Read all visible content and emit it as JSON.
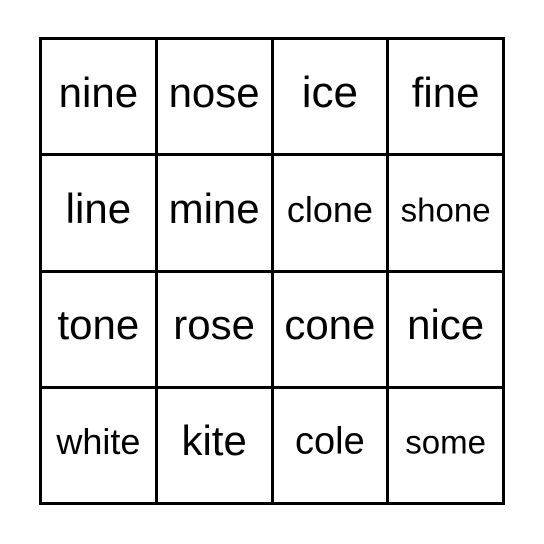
{
  "card": {
    "type": "bingo-card",
    "rows": 4,
    "columns": 4,
    "background_color": "#ffffff",
    "border_color": "#000000",
    "text_color": "#000000",
    "border_width_px": 3,
    "cells": [
      {
        "word": "nine",
        "row": 1,
        "col": 1,
        "size": "lg"
      },
      {
        "word": "nose",
        "row": 1,
        "col": 2,
        "size": "lg"
      },
      {
        "word": "ice",
        "row": 1,
        "col": 3,
        "size": "xl"
      },
      {
        "word": "fine",
        "row": 1,
        "col": 4,
        "size": "lg"
      },
      {
        "word": "line",
        "row": 2,
        "col": 1,
        "size": "lg"
      },
      {
        "word": "mine",
        "row": 2,
        "col": 2,
        "size": "lg"
      },
      {
        "word": "clone",
        "row": 2,
        "col": 3,
        "size": "sm"
      },
      {
        "word": "shone",
        "row": 2,
        "col": 4,
        "size": "xs"
      },
      {
        "word": "tone",
        "row": 3,
        "col": 1,
        "size": "lg"
      },
      {
        "word": "rose",
        "row": 3,
        "col": 2,
        "size": "lg"
      },
      {
        "word": "cone",
        "row": 3,
        "col": 3,
        "size": "lg"
      },
      {
        "word": "nice",
        "row": 3,
        "col": 4,
        "size": "lg"
      },
      {
        "word": "white",
        "row": 4,
        "col": 1,
        "size": "sm"
      },
      {
        "word": "kite",
        "row": 4,
        "col": 2,
        "size": "lg"
      },
      {
        "word": "cole",
        "row": 4,
        "col": 3,
        "size": "md"
      },
      {
        "word": "some",
        "row": 4,
        "col": 4,
        "size": "xs"
      }
    ]
  }
}
